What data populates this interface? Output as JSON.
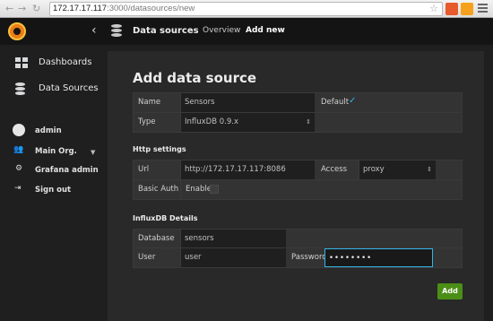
{
  "browser": {
    "url_host": "172.17.17.117",
    "url_path": ":3000/datasources/new"
  },
  "topnav": {
    "section_title": "Data sources",
    "tabs": [
      {
        "label": "Overview",
        "active": false
      },
      {
        "label": "Add new",
        "active": true
      }
    ]
  },
  "sidebar": {
    "items": [
      {
        "label": "Dashboards",
        "icon": "grid-icon"
      },
      {
        "label": "Data Sources",
        "icon": "database-icon"
      }
    ],
    "user": {
      "name": "admin",
      "org": "Main Org.",
      "admin_link": "Grafana admin",
      "signout": "Sign out"
    }
  },
  "form": {
    "title": "Add data source",
    "name_label": "Name",
    "name_value": "Sensors",
    "default_label": "Default",
    "default_checked": true,
    "type_label": "Type",
    "type_value": "InfluxDB 0.9.x",
    "http_title": "Http settings",
    "url_label": "Url",
    "url_value": "http://172.17.17.117:8086",
    "access_label": "Access",
    "access_value": "proxy",
    "basic_auth_label": "Basic Auth",
    "enable_label": "Enable",
    "influx_title": "InfluxDB Details",
    "database_label": "Database",
    "database_value": "sensors",
    "user_label": "User",
    "user_value": "user",
    "password_label": "Password",
    "password_value": "••••••••",
    "add_button": "Add"
  },
  "colors": {
    "accent": "#33b5e5",
    "add_button": "#4b8f16",
    "background": "#1f1f20",
    "panel": "#292929"
  }
}
